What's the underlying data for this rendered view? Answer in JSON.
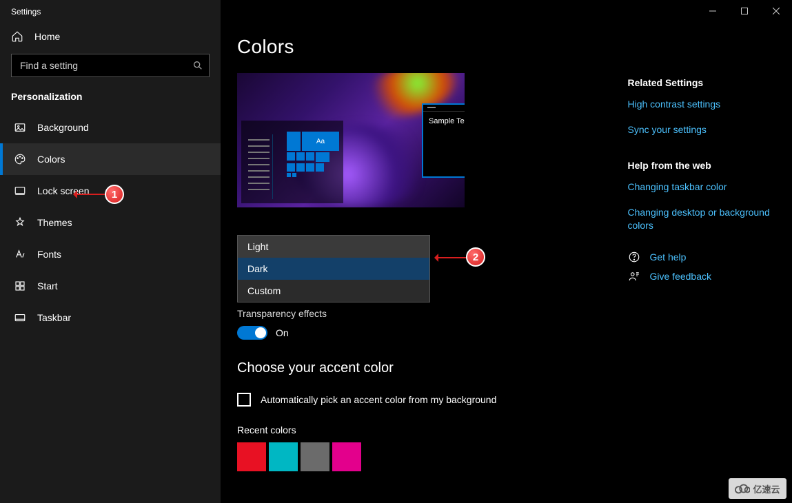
{
  "app_title": "Settings",
  "home_label": "Home",
  "search": {
    "placeholder": "Find a setting"
  },
  "section_header": "Personalization",
  "nav": [
    {
      "key": "background",
      "label": "Background"
    },
    {
      "key": "colors",
      "label": "Colors"
    },
    {
      "key": "lockscreen",
      "label": "Lock screen"
    },
    {
      "key": "themes",
      "label": "Themes"
    },
    {
      "key": "fonts",
      "label": "Fonts"
    },
    {
      "key": "start",
      "label": "Start"
    },
    {
      "key": "taskbar",
      "label": "Taskbar"
    }
  ],
  "active_nav_index": 1,
  "page_title": "Colors",
  "preview": {
    "sample_window_text": "Sample Text",
    "tile_text": "Aa"
  },
  "color_mode": {
    "options": [
      "Light",
      "Dark",
      "Custom"
    ],
    "selected_index": 1
  },
  "transparency": {
    "label": "Transparency effects",
    "on": true,
    "state_text": "On"
  },
  "accent": {
    "heading": "Choose your accent color",
    "auto_checkbox_label": "Automatically pick an accent color from my background",
    "auto_checked": false,
    "recent_label": "Recent colors",
    "recent_colors": [
      "#e81123",
      "#00b7c3",
      "#6b6b6b",
      "#e3008c"
    ]
  },
  "related": {
    "heading": "Related Settings",
    "links": [
      "High contrast settings",
      "Sync your settings"
    ]
  },
  "webhelp": {
    "heading": "Help from the web",
    "links": [
      "Changing taskbar color",
      "Changing desktop or background colors"
    ]
  },
  "support": {
    "get_help": "Get help",
    "give_feedback": "Give feedback"
  },
  "annotations": {
    "1": "1",
    "2": "2"
  },
  "watermark": "亿速云"
}
